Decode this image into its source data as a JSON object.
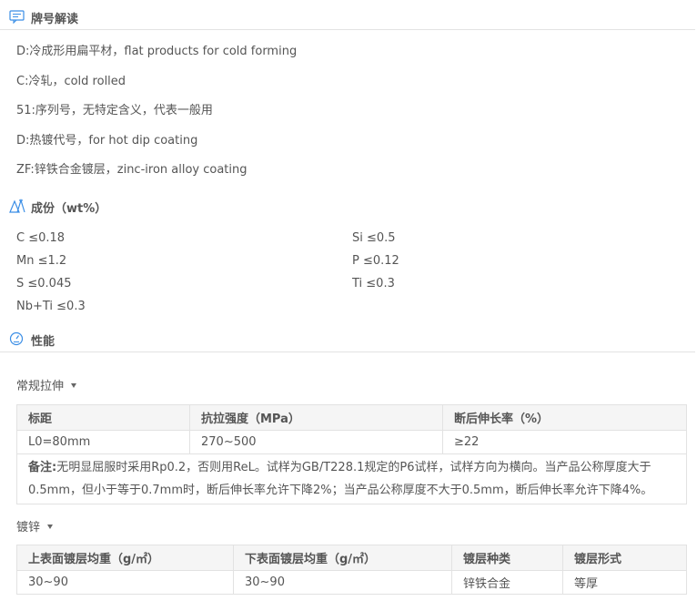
{
  "designation": {
    "title": "牌号解读",
    "lines": [
      "D:冷成形用扁平材，flat products for cold forming",
      "C:冷轧，cold rolled",
      "51:序列号，无特定含义，代表一般用",
      "D:热镀代号，for hot dip coating",
      "ZF:锌铁合金镀层，zinc-iron alloy coating"
    ]
  },
  "composition": {
    "title": "成份（wt%）",
    "items": [
      "C ≤0.18",
      "Si ≤0.5",
      "Mn ≤1.2",
      "P ≤0.12",
      "S ≤0.045",
      "Ti ≤0.3",
      "Nb+Ti ≤0.3"
    ]
  },
  "properties": {
    "title": "性能",
    "tensile": {
      "dropdown_label": "常规拉伸",
      "headers": [
        "标距",
        "抗拉强度（MPa）",
        "断后伸长率（%）"
      ],
      "row": [
        "L0=80mm",
        "270~500",
        "≥22"
      ],
      "note_label": "备注:",
      "note_text": "无明显屈服时采用Rp0.2，否则用ReL。试样为GB/T228.1规定的P6试样，试样方向为横向。当产品公称厚度大于0.5mm，但小于等于0.7mm时，断后伸长率允许下降2%；当产品公称厚度不大于0.5mm，断后伸长率允许下降4%。"
    },
    "coating": {
      "dropdown_label": "镀锌",
      "headers": [
        "上表面镀层均重（g/㎡）",
        "下表面镀层均重（g/㎡）",
        "镀层种类",
        "镀层形式"
      ],
      "row": [
        "30~90",
        "30~90",
        "锌铁合金",
        "等厚"
      ]
    }
  },
  "colors": {
    "icon_blue": "#3a8ee6",
    "border": "#e2e2e2",
    "header_bg": "#f5f5f5"
  }
}
